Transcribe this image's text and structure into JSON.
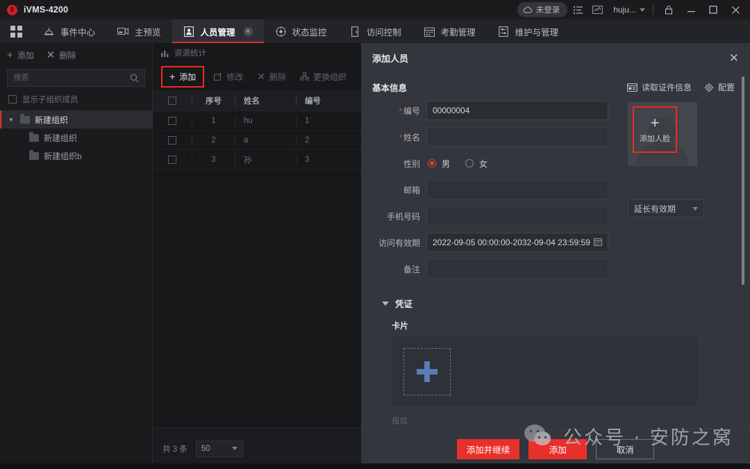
{
  "titlebar": {
    "app_title": "iVMS-4200",
    "logo_icon": "hikvision-logo-icon",
    "cloud_status": "未登录",
    "cloud_icon": "cloud-icon",
    "list_icon": "list-icon",
    "chart_icon": "chart-icon",
    "user_name": "huju...",
    "chevron_icon": "chevron-down-icon",
    "lock_icon": "lock-icon",
    "minimize_icon": "minimize-icon",
    "maximize_icon": "maximize-icon",
    "close_icon": "close-icon"
  },
  "navbar": {
    "grid_icon": "apps-grid-icon",
    "tabs": [
      {
        "label": "事件中心",
        "icon": "alarm-bell-icon",
        "active": false,
        "closable": false
      },
      {
        "label": "主预览",
        "icon": "video-camera-icon",
        "active": false,
        "closable": false
      },
      {
        "label": "人员管理",
        "icon": "person-card-icon",
        "active": true,
        "closable": true
      },
      {
        "label": "状态监控",
        "icon": "target-monitor-icon",
        "active": false,
        "closable": false
      },
      {
        "label": "访问控制",
        "icon": "door-icon",
        "active": false,
        "closable": false
      },
      {
        "label": "考勤管理",
        "icon": "calendar-icon",
        "active": false,
        "closable": false
      },
      {
        "label": "维护与管理",
        "icon": "maintenance-icon",
        "active": false,
        "closable": false
      }
    ]
  },
  "left_panel": {
    "add_label": "添加",
    "delete_label": "删除",
    "search_placeholder": "搜索",
    "search_icon": "search-icon",
    "show_sub_members_label": "显示子组织成员",
    "tree": [
      {
        "label": "新建组织",
        "level": 0,
        "selected": true,
        "expanded": true
      },
      {
        "label": "新建组织",
        "level": 1,
        "selected": false
      },
      {
        "label": "新建组织b",
        "level": 1,
        "selected": false
      }
    ]
  },
  "center_panel": {
    "resource_stat_label": "资源统计",
    "stat_icon": "bar-chart-icon",
    "actions": [
      {
        "label": "添加",
        "icon": "plus-icon",
        "highlighted": true
      },
      {
        "label": "修改",
        "icon": "edit-icon",
        "highlighted": false
      },
      {
        "label": "删除",
        "icon": "close-x-icon",
        "highlighted": false
      },
      {
        "label": "更换组织",
        "icon": "swap-org-icon",
        "highlighted": false
      }
    ],
    "columns": [
      "序号",
      "姓名",
      "编号"
    ],
    "rows": [
      {
        "seq": "1",
        "name": "hu",
        "code": "1"
      },
      {
        "seq": "2",
        "name": "a",
        "code": "2"
      },
      {
        "seq": "3",
        "name": "孙",
        "code": "3"
      }
    ],
    "total_text": "共 3 条",
    "page_size": "50"
  },
  "dialog": {
    "title": "添加人员",
    "close_icon": "close-icon",
    "section_basic": "基本信息",
    "read_card_label": "读取证件信息",
    "read_card_icon": "id-card-icon",
    "config_label": "配置",
    "config_icon": "gear-icon",
    "fields": {
      "code_label": "编号",
      "code_value": "00000004",
      "name_label": "姓名",
      "name_value": "",
      "gender_label": "性别",
      "gender_male": "男",
      "gender_female": "女",
      "email_label": "邮箱",
      "email_value": "",
      "phone_label": "手机号码",
      "phone_value": "",
      "validity_label": "访问有效期",
      "validity_value": "2022-09-05 00:00:00-2032-09-04 23:59:59",
      "calendar_icon": "calendar-icon",
      "remark_label": "备注",
      "remark_value": ""
    },
    "face": {
      "add_face_label": "添加人脸",
      "plus_icon": "plus-icon",
      "extend_validity_label": "延长有效期",
      "chevron_icon": "chevron-down-icon"
    },
    "credential": {
      "section_label": "凭证",
      "card_label": "卡片",
      "add_card_icon": "plus-icon",
      "next_section_label": "指纹"
    },
    "footer": {
      "add_continue_label": "添加并继续",
      "add_label": "添加",
      "cancel_label": "取消"
    }
  },
  "watermark": {
    "text": "公众号 · 安防之窝",
    "logo_icon": "wechat-logo-icon"
  },
  "colors": {
    "accent_red": "#e8302a",
    "highlight_red": "#f02a22",
    "dialog_bg": "#33363d",
    "app_bg": "#1b1b1e",
    "blue_dash": "#5b7bb4"
  }
}
